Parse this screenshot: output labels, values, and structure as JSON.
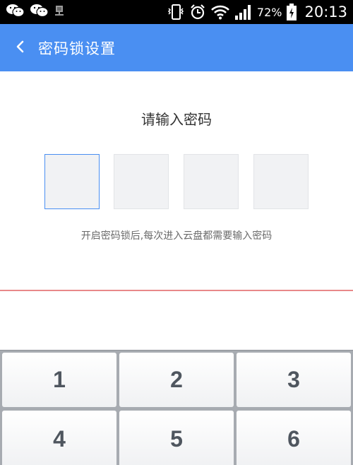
{
  "status_bar": {
    "battery_percent": "72%",
    "time": "20:13",
    "icons": [
      "wechat-icon",
      "wechat-icon",
      "network-transfer-icon",
      "phone-vibrate-icon",
      "alarm-icon",
      "wifi-icon",
      "signal-icon",
      "battery-charging-icon"
    ]
  },
  "header": {
    "title": "密码锁设置",
    "back_icon": "chevron-left-icon",
    "background_color": "#4a8ff2"
  },
  "main": {
    "prompt": "请输入密码",
    "pin_length": 4,
    "hint": "开启密码锁后,每次进入云盘都需要输入密码"
  },
  "keypad": {
    "keys": [
      "1",
      "2",
      "3",
      "4",
      "5",
      "6"
    ]
  },
  "colors": {
    "accent": "#4a8ff2",
    "divider": "#e8898a",
    "keypad_bg": "#a7abb1"
  }
}
